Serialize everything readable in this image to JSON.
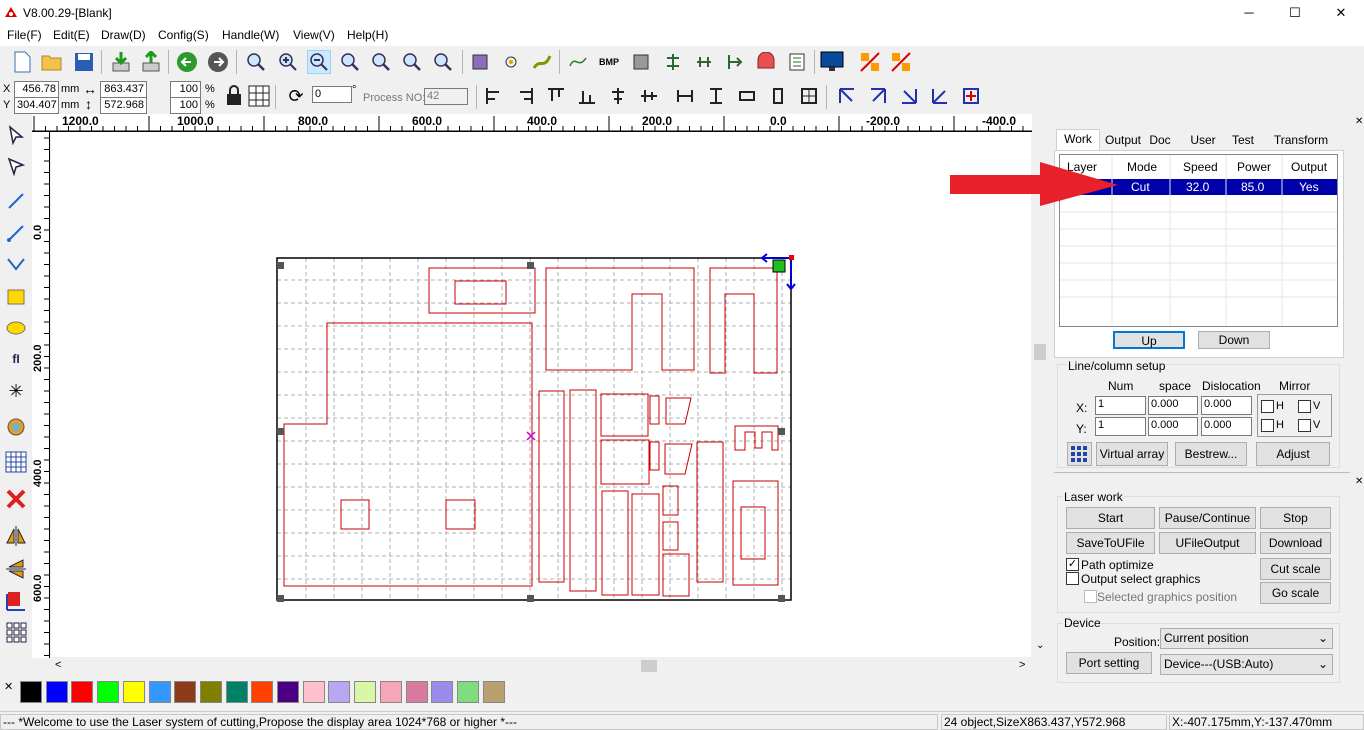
{
  "app": {
    "title": "V8.00.29-[Blank]"
  },
  "window_controls": {
    "minimize": "─",
    "maximize": "☐",
    "close": "✕"
  },
  "menu": [
    "File(F)",
    "Edit(E)",
    "Draw(D)",
    "Config(S)",
    "Handle(W)",
    "View(V)",
    "Help(H)"
  ],
  "position": {
    "x_label": "X",
    "y_label": "Y",
    "x_value": "456.78",
    "y_value": "304.407",
    "unit": "mm",
    "width": "863.437",
    "height": "572.968",
    "scale_x": "100",
    "scale_y": "100",
    "percent": "%"
  },
  "rotate": {
    "value": "0",
    "degree": "°",
    "process_label": "Process NO:",
    "process_value": "42"
  },
  "ruler_top": [
    "1200.0",
    "1000.0",
    "800.0",
    "600.0",
    "400.0",
    "200.0",
    "0.0",
    "-200.0",
    "-400.0"
  ],
  "ruler_left": [
    "0.0",
    "200.0",
    "400.0",
    "600.0"
  ],
  "colors": [
    "#000000",
    "#0000ff",
    "#ff0000",
    "#00ff00",
    "#ffff00",
    "#3399ff",
    "#8b3a1a",
    "#808000",
    "#008066",
    "#ff4000",
    "#4b0082",
    "#ffc0cb",
    "#b8a6f0",
    "#d7f7a6",
    "#f7a6b8",
    "#d97aa0",
    "#9a8ce8",
    "#7fdc7f",
    "#b8a070"
  ],
  "panel": {
    "tabs": [
      "Work",
      "Output",
      "Doc",
      "User",
      "Test",
      "Transform"
    ],
    "active_tab": "Work",
    "layer_headers": [
      "Layer",
      "Mode",
      "Speed",
      "Power",
      "Output"
    ],
    "layers": [
      {
        "layer": "",
        "mode": "Cut",
        "speed": "32.0",
        "power": "85.0",
        "output": "Yes"
      }
    ],
    "up_label": "Up",
    "down_label": "Down",
    "line_column_title": "Line/column setup",
    "grid_headers": {
      "num": "Num",
      "space": "space",
      "dislocation": "Dislocation",
      "mirror": "Mirror"
    },
    "x_row": {
      "label": "X:",
      "num": "1",
      "space": "0.000",
      "dislocation": "0.000",
      "h": "H",
      "v": "V"
    },
    "y_row": {
      "label": "Y:",
      "num": "1",
      "space": "0.000",
      "dislocation": "0.000",
      "h": "H",
      "v": "V"
    },
    "virtual_array": "Virtual array",
    "bestrew": "Bestrew...",
    "adjust": "Adjust",
    "laser_work_title": "Laser work",
    "start": "Start",
    "pause": "Pause/Continue",
    "stop": "Stop",
    "save_u": "SaveToUFile",
    "ufile_output": "UFileOutput",
    "download": "Download",
    "path_optimize": "Path optimize",
    "output_select": "Output select graphics",
    "selected_position": "Selected graphics position",
    "cut_scale": "Cut scale",
    "go_scale": "Go scale",
    "device_title": "Device",
    "position_label": "Position:",
    "position_value": "Current position",
    "port_setting": "Port setting",
    "device_value": "Device---(USB:Auto)"
  },
  "status": {
    "message": "--- *Welcome to use the Laser system of cutting,Propose the display area 1024*768 or higher *---",
    "objects": "24 object,SizeX863.437,Y572.968",
    "coords": "X:-407.175mm,Y:-137.470mm"
  },
  "accent": {
    "selection": "#0000aa",
    "arrow": "#e8202a",
    "shape": "#cc0000"
  }
}
